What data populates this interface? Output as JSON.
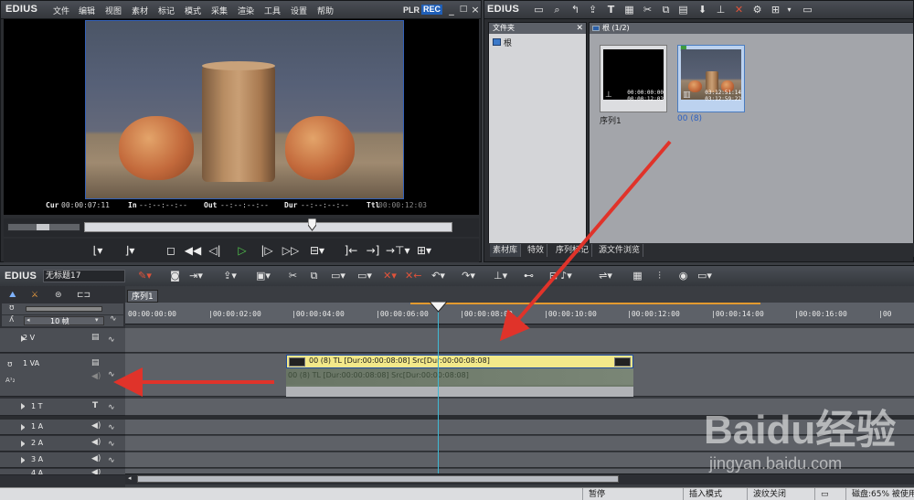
{
  "player": {
    "logo": "EDIUS",
    "menu": [
      "文件",
      "编辑",
      "视图",
      "素材",
      "标记",
      "模式",
      "采集",
      "渲染",
      "工具",
      "设置",
      "帮助"
    ],
    "plr": "PLR",
    "rec": "REC",
    "window_buttons": [
      "_",
      "□",
      "×"
    ],
    "timecodes": {
      "cur_label": "Cur",
      "cur_value": "00:00:07:11",
      "in_label": "In",
      "in_value": "--:--:--:--",
      "out_label": "Out",
      "out_value": "--:--:--:--",
      "dur_label": "Dur",
      "dur_value": "--:--:--:--",
      "ttl_label": "Ttl",
      "ttl_value": "00:00:12:03"
    },
    "scrubber_position": 0.6
  },
  "bin": {
    "logo": "EDIUS",
    "folder_pane_title": "文件夹",
    "folder_root": "根",
    "clip_pane_title": "根 (1/2)",
    "clips": [
      {
        "name": "序列1",
        "tc_in": "00:00:00:00",
        "tc_out": "00:00:12:03",
        "selected": false
      },
      {
        "name": "00 (8)",
        "tc_in": "03:12:51:14",
        "tc_out": "03:12:59:22",
        "selected": true
      }
    ],
    "tabs": [
      "素材库",
      "特效",
      "序列标记",
      "源文件浏览"
    ]
  },
  "timeline": {
    "logo": "EDIUS",
    "sequence_name": "无标题17",
    "sequence_tab": "序列1",
    "zoom": "10 帧",
    "ruler_labels": [
      "00:00:00:00",
      "|00:00:02:00",
      "|00:00:04:00",
      "|00:00:06:00",
      "|00:00:08:00",
      "|00:00:10:00",
      "|00:00:12:00",
      "|00:00:14:00",
      "|00:00:16:00",
      "|00"
    ],
    "tracks": [
      {
        "name": "2 V",
        "type": "V"
      },
      {
        "name": "1 VA",
        "type": "VA",
        "sub": "A1 2"
      },
      {
        "name": "1 T",
        "type": "T"
      },
      {
        "name": "1 A",
        "type": "A"
      },
      {
        "name": "2 A",
        "type": "A"
      },
      {
        "name": "3 A",
        "type": "A"
      },
      {
        "name": "4 A",
        "type": "A"
      }
    ],
    "video_clip_label": "00 (8)   TL [Dur:00:00:08:08]   Src[Dur:00:00:08:08]",
    "audio_clip_label": "00 (8)   TL [Dur:00:00:08:08]   Src[Dur:00:00:08:08]"
  },
  "statusbar": {
    "items": [
      "暂停",
      "插入模式",
      "波纹关闭",
      "磁盘:65% 被使用"
    ]
  },
  "colors": {
    "accent_blue": "#1f5fb8",
    "play_green": "#53c94d",
    "clip_yellow": "#f3e98a",
    "playhead_cyan": "#3fb9d4",
    "annotation_red": "#e0332a"
  },
  "watermark": {
    "brand": "Baidu经验",
    "url": "jingyan.baidu.com"
  }
}
